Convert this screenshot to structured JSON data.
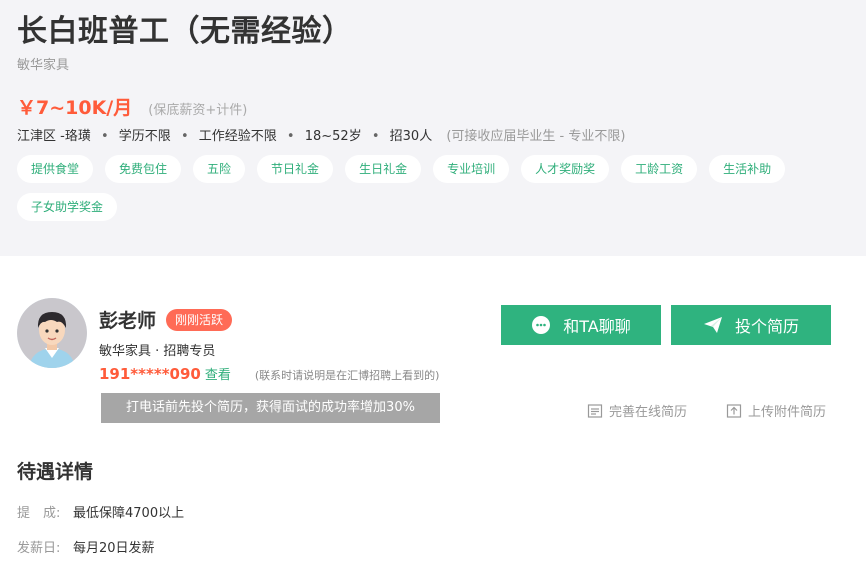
{
  "job": {
    "title": "长白班普工（无需经验）",
    "company": "敏华家具",
    "salary": "￥7~10K/月",
    "salary_note": "(保底薪资+计件)",
    "location": "江津区 -珞璜",
    "education": "学历不限",
    "experience": "工作经验不限",
    "age": "18~52岁",
    "headcount": "招30人",
    "extra_note": "(可接收应届毕业生 - 专业不限)",
    "tags": [
      "提供食堂",
      "免费包住",
      "五险",
      "节日礼金",
      "生日礼金",
      "专业培训",
      "人才奖励奖",
      "工龄工资",
      "生活补助",
      "子女助学奖金"
    ]
  },
  "recruiter": {
    "name": "彭老师",
    "status": "刚刚活跃",
    "role": "敏华家具 · 招聘专员",
    "phone": "191*****090",
    "view_label": "查看",
    "phone_note": "(联系时请说明是在汇博招聘上看到的)",
    "tooltip": "打电话前先投个简历，获得面试的成功率增加30%"
  },
  "actions": {
    "chat_label": "和TA聊聊",
    "resume_label": "投个简历",
    "online_resume_label": "完善在线简历",
    "attach_resume_label": "上传附件简历"
  },
  "benefits": {
    "section_title": "待遇详情",
    "rows": [
      {
        "label": "提　成:",
        "value": "最低保障4700以上"
      },
      {
        "label": "发薪日:",
        "value": "每月20日发薪"
      }
    ]
  },
  "colors": {
    "accent_green": "#2fb37f",
    "salary_red": "#ff5b3a",
    "badge_red": "#ff6b56"
  }
}
